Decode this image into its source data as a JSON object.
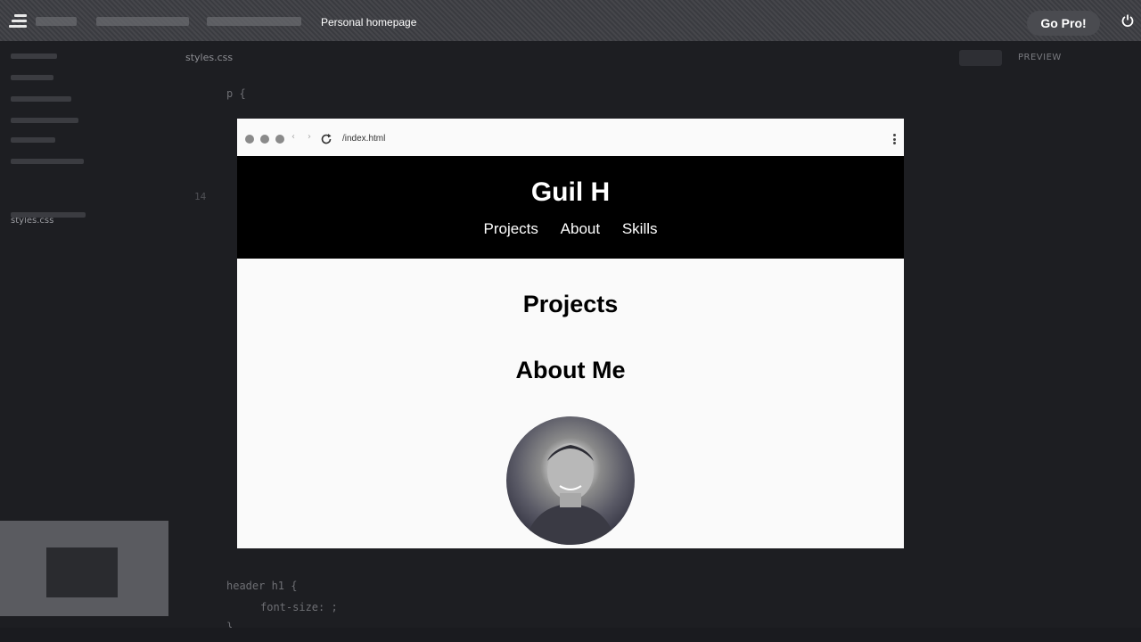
{
  "topbar": {
    "project_title": "Personal homepage",
    "go_pro_label": "Go Pro!"
  },
  "sidebar": {
    "active_file": "styles.css"
  },
  "editor": {
    "file_tab": "styles.css",
    "preview_label": "PREVIEW",
    "code_lines": [
      "p {",
      "header h1 {",
      "font-size: ;",
      "}"
    ]
  },
  "browser": {
    "url": "/index.html"
  },
  "site": {
    "title": "Guil H",
    "nav": [
      "Projects",
      "About",
      "Skills"
    ],
    "projects_heading": "Projects",
    "about_heading": "About Me"
  }
}
